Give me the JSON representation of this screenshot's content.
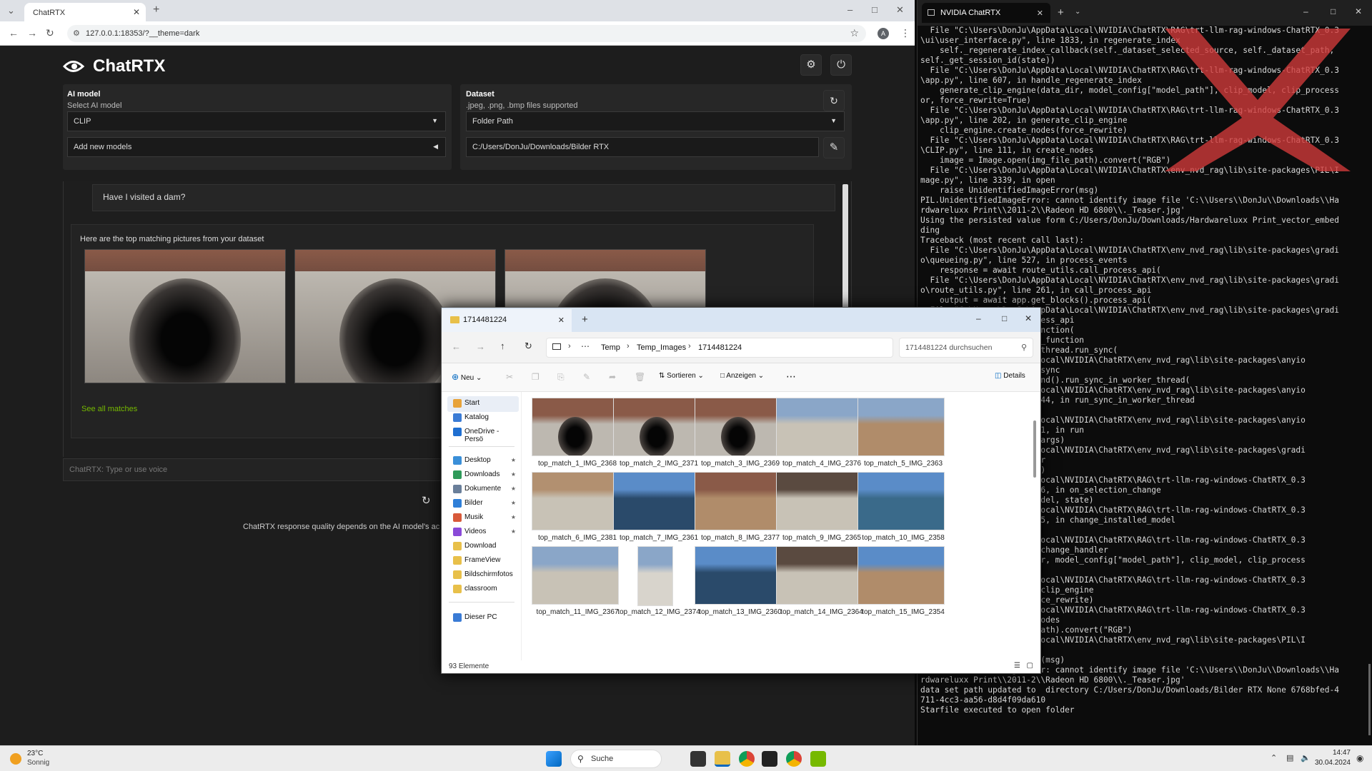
{
  "browser": {
    "tab_title": "ChatRTX",
    "url": "127.0.0.1:18353/?__theme=dark",
    "avatar_letter": "A"
  },
  "chatrtx": {
    "app_title": "ChatRTX",
    "ai_model": {
      "title": "AI model",
      "label": "Select AI model",
      "value": "CLIP",
      "add_models": "Add new models"
    },
    "dataset": {
      "title": "Dataset",
      "hint": ".jpeg, .png, .bmp files supported",
      "type": "Folder Path",
      "path": "C:/Users/DonJu/Downloads/Bilder RTX"
    },
    "chat": {
      "question": "Have I visited a dam?",
      "answer_intro": "Here are the top matching pictures from your dataset",
      "see_all": "See all matches",
      "input_placeholder": "ChatRTX: Type or use voice",
      "footer_note": "ChatRTX response quality depends on the AI model's ac"
    }
  },
  "terminal": {
    "tab_title": "NVIDIA ChatRTX",
    "lines": [
      "  File \"C:\\Users\\DonJu\\AppData\\Local\\NVIDIA\\ChatRTX\\RAG\\trt-llm-rag-windows-ChatRTX_0.3",
      "\\ui\\user_interface.py\", line 1833, in regenerate_index",
      "    self._regenerate_index_callback(self._dataset_selected_source, self._dataset_path,",
      "self._get_session_id(state))",
      "  File \"C:\\Users\\DonJu\\AppData\\Local\\NVIDIA\\ChatRTX\\RAG\\trt-llm-rag-windows-ChatRTX_0.3",
      "\\app.py\", line 607, in handle_regenerate_index",
      "    generate_clip_engine(data_dir, model_config[\"model_path\"], clip_model, clip_process",
      "or, force_rewrite=True)",
      "  File \"C:\\Users\\DonJu\\AppData\\Local\\NVIDIA\\ChatRTX\\RAG\\trt-llm-rag-windows-ChatRTX_0.3",
      "\\app.py\", line 202, in generate_clip_engine",
      "    clip_engine.create_nodes(force_rewrite)",
      "  File \"C:\\Users\\DonJu\\AppData\\Local\\NVIDIA\\ChatRTX\\RAG\\trt-llm-rag-windows-ChatRTX_0.3",
      "\\CLIP.py\", line 111, in create_nodes",
      "    image = Image.open(img_file_path).convert(\"RGB\")",
      "  File \"C:\\Users\\DonJu\\AppData\\Local\\NVIDIA\\ChatRTX\\env_nvd_rag\\lib\\site-packages\\PIL\\I",
      "mage.py\", line 3339, in open",
      "    raise UnidentifiedImageError(msg)",
      "PIL.UnidentifiedImageError: cannot identify image file 'C:\\\\Users\\\\DonJu\\\\Downloads\\\\Ha",
      "rdwareluxx Print\\\\2011-2\\\\Radeon HD 6800\\\\._Teaser.jpg'",
      "Using the persisted value form C:/Users/DonJu/Downloads/Hardwareluxx Print_vector_embed",
      "ding",
      "Traceback (most recent call last):",
      "  File \"C:\\Users\\DonJu\\AppData\\Local\\NVIDIA\\ChatRTX\\env_nvd_rag\\lib\\site-packages\\gradi",
      "o\\queueing.py\", line 527, in process_events",
      "    response = await route_utils.call_process_api(",
      "  File \"C:\\Users\\DonJu\\AppData\\Local\\NVIDIA\\ChatRTX\\env_nvd_rag\\lib\\site-packages\\gradi",
      "o\\route_utils.py\", line 261, in call_process_api",
      "    output = await app.get_blocks().process_api(",
      "  File \"C:\\Users\\DonJu\\AppData\\Local\\NVIDIA\\ChatRTX\\env_nvd_rag\\lib\\site-packages\\gradi",
      "                  in process_api",
      "                  call_function(",
      "                  in call_function",
      "                  yio.to_thread.run_sync(",
      "                  pData\\Local\\NVIDIA\\ChatRTX\\env_nvd_rag\\lib\\site-packages\\anyio",
      "                  in run_sync",
      "                  c_backend().run_sync_in_worker_thread(",
      "                  pData\\Local\\NVIDIA\\ChatRTX\\env_nvd_rag\\lib\\site-packages\\anyio",
      "                  line 2144, in run_sync_in_worker_thread",
      "",
      "                  pData\\Local\\NVIDIA\\ChatRTX\\env_nvd_rag\\lib\\site-packages\\anyio",
      "                  line 851, in run",
      "                  func, *args)",
      "                  pData\\Local\\NVIDIA\\ChatRTX\\env_nvd_rag\\lib\\site-packages\\gradi",
      "                   wrapper",
      "                  *kwargs)",
      "                  pData\\Local\\NVIDIA\\ChatRTX\\RAG\\trt-llm-rag-windows-ChatRTX_0.3",
      "                  ine 1356, in on_selection_change",
      "                  l(newModel, state)",
      "                  pData\\Local\\NVIDIA\\ChatRTX\\RAG\\trt-llm-rag-windows-ChatRTX_0.3",
      "                  ine 1345, in change_installed_model",
      "                  llback(",
      "                  pData\\Local\\NVIDIA\\ChatRTX\\RAG\\trt-llm-rag-windows-ChatRTX_0.3",
      "                  _model_change_handler",
      "                  data_dir, model_config[\"model_path\"], clip_model, clip_process",
      "",
      "                  pData\\Local\\NVIDIA\\ChatRTX\\RAG\\trt-llm-rag-windows-ChatRTX_0.3",
      "                  nerate_clip_engine",
      "                  des(force_rewrite)",
      "                  pData\\Local\\NVIDIA\\ChatRTX\\RAG\\trt-llm-rag-windows-ChatRTX_0.3",
      "                  reate_nodes",
      "                  _file_path).convert(\"RGB\")",
      "                  pData\\Local\\NVIDIA\\ChatRTX\\env_nvd_rag\\lib\\site-packages\\PIL\\I",
      "                  pen",
      "                  geError(msg)",
      "PIL.UnidentifiedImageError: cannot identify image file 'C:\\\\Users\\\\DonJu\\\\Downloads\\\\Ha",
      "rdwareluxx Print\\\\2011-2\\\\Radeon HD 6800\\\\._Teaser.jpg'",
      "data set path updated to  directory C:/Users/DonJu/Downloads/Bilder RTX None 6768bfed-4",
      "711-4cc3-aa56-d8d4f09da610",
      "Starfile executed to open folder"
    ]
  },
  "explorer": {
    "tab_title": "1714481224",
    "breadcrumb": [
      "Temp",
      "Temp_Images",
      "1714481224"
    ],
    "search_placeholder": "1714481224 durchsuchen",
    "cmd": {
      "new": "Neu",
      "sort": "Sortieren",
      "view": "Anzeigen",
      "details": "Details"
    },
    "nav": [
      {
        "label": "Start",
        "color": "#e8a33a",
        "pinned": false
      },
      {
        "label": "Katalog",
        "color": "#3a7bd5",
        "pinned": false
      },
      {
        "label": "OneDrive - Persö",
        "color": "#1f6fd1",
        "pinned": false
      },
      {
        "label": "Desktop",
        "color": "#3a8fd8",
        "pinned": true
      },
      {
        "label": "Downloads",
        "color": "#2f9a5a",
        "pinned": true
      },
      {
        "label": "Dokumente",
        "color": "#6a7f9a",
        "pinned": true
      },
      {
        "label": "Bilder",
        "color": "#2f7fd8",
        "pinned": true
      },
      {
        "label": "Musik",
        "color": "#d85a3a",
        "pinned": true
      },
      {
        "label": "Videos",
        "color": "#8a4ad8",
        "pinned": true
      },
      {
        "label": "Download",
        "color": "#e8c04a",
        "pinned": false
      },
      {
        "label": "FrameView",
        "color": "#e8c04a",
        "pinned": false
      },
      {
        "label": "Bildschirmfotos",
        "color": "#e8c04a",
        "pinned": false
      },
      {
        "label": "classroom",
        "color": "#e8c04a",
        "pinned": false
      },
      {
        "label": "Dieser PC",
        "color": "#3a7bd5",
        "pinned": false
      }
    ],
    "files": [
      "top_match_1_IMG_2368",
      "top_match_2_IMG_2371",
      "top_match_3_IMG_2369",
      "top_match_4_IMG_2376",
      "top_match_5_IMG_2363",
      "top_match_6_IMG_2381",
      "top_match_7_IMG_2361",
      "top_match_8_IMG_2377",
      "top_match_9_IMG_2365",
      "top_match_10_IMG_2358",
      "top_match_11_IMG_2367",
      "top_match_12_IMG_2374",
      "top_match_13_IMG_2360",
      "top_match_14_IMG_2364",
      "top_match_15_IMG_2354"
    ],
    "item_count": "93 Elemente"
  },
  "taskbar": {
    "weather_temp": "23°C",
    "weather_text": "Sonnig",
    "search_label": "Suche",
    "time": "14:47",
    "date": "30.04.2024"
  },
  "colors": {
    "accent_green": "#76b900",
    "explorer_blue": "#0067c0"
  }
}
